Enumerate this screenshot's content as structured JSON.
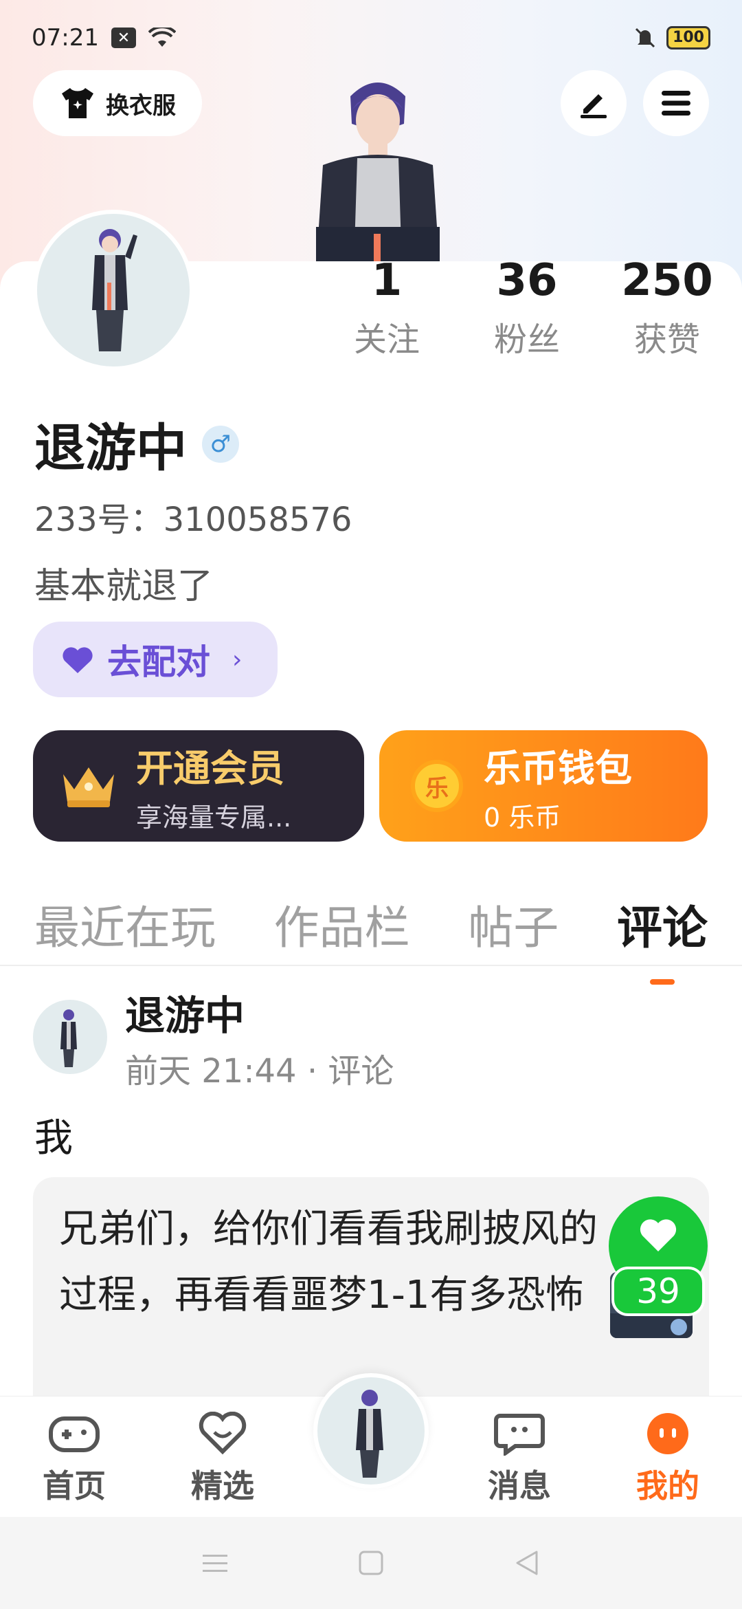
{
  "status_bar": {
    "time": "07:21",
    "battery": "100"
  },
  "header": {
    "outfit_label": "换衣服"
  },
  "stats": [
    {
      "value": "1",
      "label": "关注"
    },
    {
      "value": "36",
      "label": "粉丝"
    },
    {
      "value": "250",
      "label": "获赞"
    }
  ],
  "profile": {
    "name": "退游中",
    "gender_symbol": "♂",
    "uid": "233号：310058576",
    "bio": "基本就退了",
    "match_label": "去配对"
  },
  "cards": {
    "vip_title": "开通会员",
    "vip_sub": "享海量专属...",
    "coin_title": "乐币钱包",
    "coin_sub": "0 乐币",
    "coin_symbol": "乐"
  },
  "tabs": [
    "最近在玩",
    "作品栏",
    "帖子",
    "评论"
  ],
  "post": {
    "author": "退游中",
    "meta": "前天 21:44 · 评论",
    "text": "我",
    "quote": "兄弟们，给你们看看我刷披风的过程，再看看噩梦1-1有多恐怖",
    "like_count": "39"
  },
  "bottom_nav": [
    "首页",
    "精选",
    "消息",
    "我的"
  ],
  "colors": {
    "accent": "#ff6a1a",
    "match": "#6a4fd6",
    "like": "#19c83a"
  }
}
